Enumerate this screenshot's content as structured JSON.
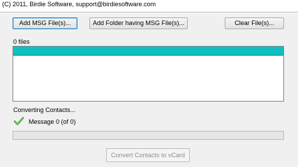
{
  "header": {
    "copyright": "(C) 2011, Birdie Software, support@birdiesoftware.com"
  },
  "toolbar": {
    "add_msg_label": "Add MSG File(s)...",
    "add_folder_label": "Add Folder having MSG File(s)...",
    "clear_label": "Clear File(s)..."
  },
  "file_list": {
    "count_label": "0 files",
    "selected_row_color": "#10bfbf"
  },
  "status": {
    "converting_label": "Converting Contacts...",
    "message_label": "Message 0 (of 0)",
    "check_icon": "green-checkmark",
    "progress_fraction": 0
  },
  "footer": {
    "convert_label": "Convert Contacts to vCard"
  }
}
